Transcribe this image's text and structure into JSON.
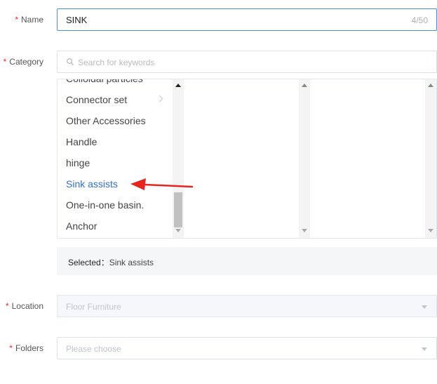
{
  "form": {
    "name": {
      "label": "Name",
      "value": "SINK",
      "counter": "4/50"
    },
    "category": {
      "label": "Category",
      "search_placeholder": "Search for keywords",
      "column1": {
        "items": [
          "Colloidal particles",
          "Connector set",
          "Other Accessories",
          "Handle",
          "hinge",
          "Sink assists",
          "One-in-one basin.",
          "Anchor"
        ],
        "active_item": "Sink assists"
      },
      "selected_label": "Selected：",
      "selected_value": "Sink assists"
    },
    "location": {
      "label": "Location",
      "value": "Floor Furniture"
    },
    "folders": {
      "label": "Folders",
      "placeholder": "Please choose"
    },
    "required_mark": "*"
  },
  "colors": {
    "accent": "#2f6fe0",
    "focus_border": "#4a90e2",
    "required": "#f5222d",
    "arrow": "#e8241f"
  }
}
